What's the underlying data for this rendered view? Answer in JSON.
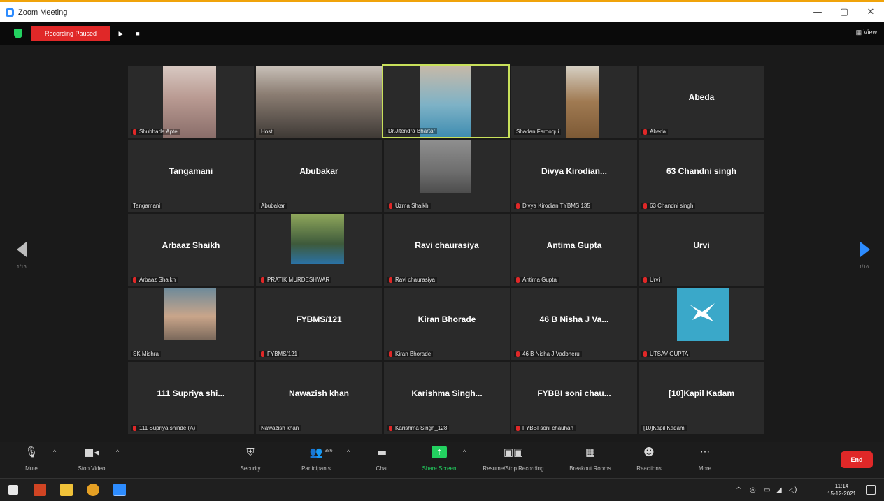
{
  "window": {
    "title": "Zoom Meeting",
    "controls": {
      "minimize": "—",
      "maximize": "▢",
      "close": "✕"
    }
  },
  "topbar": {
    "recording_status": "Recording Paused",
    "view_label": "View"
  },
  "tiles": [
    {
      "display": "",
      "label": "Shubhada Apte",
      "muted": true
    },
    {
      "display": "",
      "label": "Host",
      "muted": false
    },
    {
      "display": "",
      "label": "Dr.Jitendra Bhartar",
      "muted": false
    },
    {
      "display": "",
      "label": "Shadan Farooqui",
      "muted": false
    },
    {
      "display": "Abeda",
      "label": "Abeda",
      "muted": true
    },
    {
      "display": "Tangamani",
      "label": "Tangamani",
      "muted": false
    },
    {
      "display": "Abubakar",
      "label": "Abubakar",
      "muted": false
    },
    {
      "display": "",
      "label": "Uzma Shaikh",
      "muted": true
    },
    {
      "display": "Divya Kirodian...",
      "label": "Divya Kirodian TYBMS 135",
      "muted": true
    },
    {
      "display": "63 Chandni singh",
      "label": "63 Chandni singh",
      "muted": true
    },
    {
      "display": "Arbaaz Shaikh",
      "label": "Arbaaz Shaikh",
      "muted": true
    },
    {
      "display": "",
      "label": "PRATIK MURDESHWAR",
      "muted": true
    },
    {
      "display": "Ravi chaurasiya",
      "label": "Ravi chaurasiya",
      "muted": true
    },
    {
      "display": "Antima Gupta",
      "label": "Antima Gupta",
      "muted": true
    },
    {
      "display": "Urvi",
      "label": "Urvi",
      "muted": true
    },
    {
      "display": "",
      "label": "SK Mishra",
      "muted": false
    },
    {
      "display": "FYBMS/121",
      "label": "FYBMS/121",
      "muted": true
    },
    {
      "display": "Kiran Bhorade",
      "label": "Kiran Bhorade",
      "muted": true
    },
    {
      "display": "46 B Nisha J Va...",
      "label": "46 B Nisha J Vadbheru",
      "muted": true
    },
    {
      "display": "",
      "label": "UTSAV GUPTA",
      "muted": true
    },
    {
      "display": "111 Supriya shi...",
      "label": "111 Supriya shinde (A)",
      "muted": true
    },
    {
      "display": "Nawazish khan",
      "label": "Nawazish khan",
      "muted": false
    },
    {
      "display": "Karishma Singh...",
      "label": "Karishma Singh_128",
      "muted": true
    },
    {
      "display": "FYBBI soni chau...",
      "label": "FYBBI soni chauhan",
      "muted": true
    },
    {
      "display": "[10]Kapil Kadam",
      "label": "[10]Kapil Kadam",
      "muted": false
    }
  ],
  "pager": {
    "left": "1/16",
    "right": "1/16"
  },
  "toolbar": {
    "mute": "Mute",
    "stop_video": "Stop Video",
    "security": "Security",
    "participants": "Participants",
    "participants_count": "386",
    "chat": "Chat",
    "share_screen": "Share Screen",
    "resume_recording": "Resume/Stop Recording",
    "breakout_rooms": "Breakout Rooms",
    "reactions": "Reactions",
    "more": "More",
    "end": "End"
  },
  "taskbar": {
    "time": "11:14",
    "date": "15-12-2021"
  },
  "colors": {
    "accent_blue": "#2d8cff",
    "record_red": "#e02828",
    "share_green": "#23d160",
    "active_border": "#c8e05a"
  }
}
